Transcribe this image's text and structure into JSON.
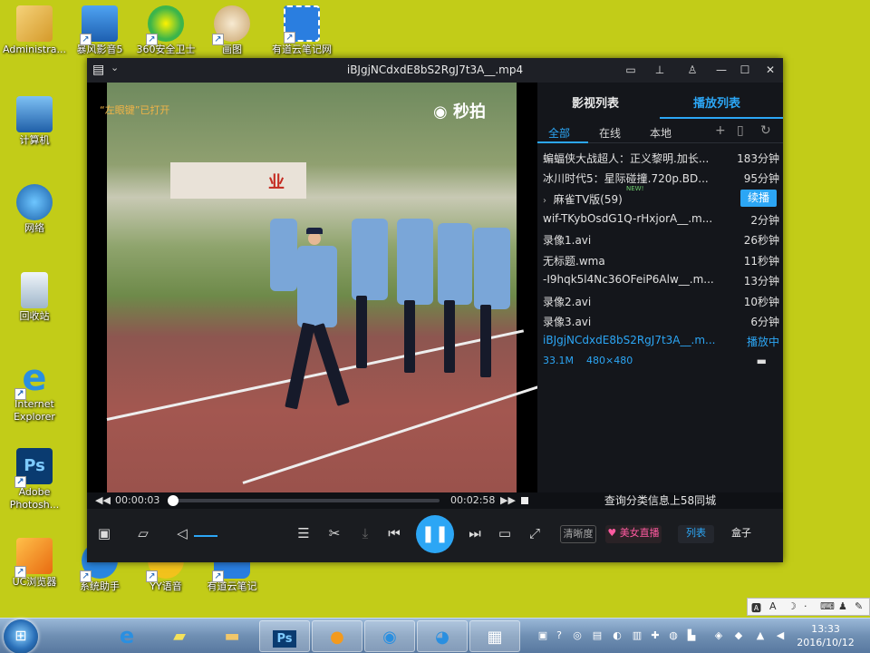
{
  "desktop": {
    "icons_col1": [
      {
        "label": "Administra...",
        "icon": "user-folder-icon",
        "color": "#e8b84a"
      },
      {
        "label": "计算机",
        "icon": "computer-icon",
        "color": "#4a90d9"
      },
      {
        "label": "网络",
        "icon": "network-icon",
        "color": "#2f7bd0"
      },
      {
        "label": "回收站",
        "icon": "recycle-bin-icon",
        "color": "#d8e4ee"
      },
      {
        "label": "Internet Explorer",
        "icon": "ie-icon",
        "color": "#2a8fe0"
      },
      {
        "label": "Adobe Photosh...",
        "icon": "photoshop-icon",
        "color": "#0a3b70"
      },
      {
        "label": "UC浏览器",
        "icon": "uc-browser-icon",
        "color": "#f39a1e"
      }
    ],
    "icons_col2": [
      {
        "label": "暴风影音5",
        "icon": "baofeng-icon",
        "color": "#1d72c8"
      },
      {
        "label": "360安全卫士",
        "icon": "360-icon",
        "color": "#3cb54a"
      },
      {
        "label": "画图",
        "icon": "paint-icon",
        "color": "#f0e2c8"
      },
      {
        "label": "有道云笔记网",
        "icon": "youdao-note-icon",
        "color": "#2a7ee0"
      }
    ],
    "icons_col3": [
      {
        "label": "系统助手",
        "icon": "system-helper-icon",
        "color": "#2a86e0"
      },
      {
        "label": "YY语音",
        "icon": "yy-icon",
        "color": "#f2c21c"
      },
      {
        "label": "有道云笔记",
        "icon": "youdao-note-icon",
        "color": "#2a7ee0"
      }
    ]
  },
  "player": {
    "title": "iBJgjNCdxdE8bS2RgJ7t3A__.mp4",
    "video": {
      "overlay_text": "“左眼键”已打开",
      "watermark": "秒拍",
      "banner_text": "业"
    },
    "panel": {
      "tab_library": "影视列表",
      "tab_playlist": "播放列表",
      "sub_all": "全部",
      "sub_online": "在线",
      "sub_local": "本地",
      "items": [
        {
          "name": "蝙蝠侠大战超人：正义黎明.加长...",
          "duration": "183分钟"
        },
        {
          "name": "冰川时代5：星际碰撞.720p.BD...",
          "duration": "95分钟"
        },
        {
          "name": "麻雀TV版(59)",
          "duration": "",
          "action": "续播",
          "tag": "NEW!"
        },
        {
          "name": "wif-TKybOsdG1Q-rHxjorA__.m...",
          "duration": "2分钟"
        },
        {
          "name": "录像1.avi",
          "duration": "26秒钟"
        },
        {
          "name": "无标题.wma",
          "duration": "11秒钟"
        },
        {
          "name": "-I9hqk5l4Nc36OFeiP6Alw__.m...",
          "duration": "13分钟"
        },
        {
          "name": "录像2.avi",
          "duration": "10秒钟"
        },
        {
          "name": "录像3.avi",
          "duration": "6分钟"
        },
        {
          "name": "iBJgjNCdxdE8bS2RgJ7t3A__.m...",
          "duration": "播放中"
        }
      ],
      "file_size": "33.1M",
      "resolution": "480×480"
    },
    "seek": {
      "current_time": "00:00:03",
      "total_time": "00:02:58",
      "progress": 0.02,
      "ad_text": "查询分类信息上58同城"
    },
    "controls": {
      "quality_label": "清晰度",
      "live_label": "美女直播",
      "list_label": "列表",
      "box_label": "盒子",
      "volume_level": 0.5
    }
  },
  "tray": {
    "time": "13:33",
    "date": "2016/10/12"
  },
  "colors": {
    "accent": "#2ca6f5",
    "desktop_bg": "#c2cc18"
  }
}
